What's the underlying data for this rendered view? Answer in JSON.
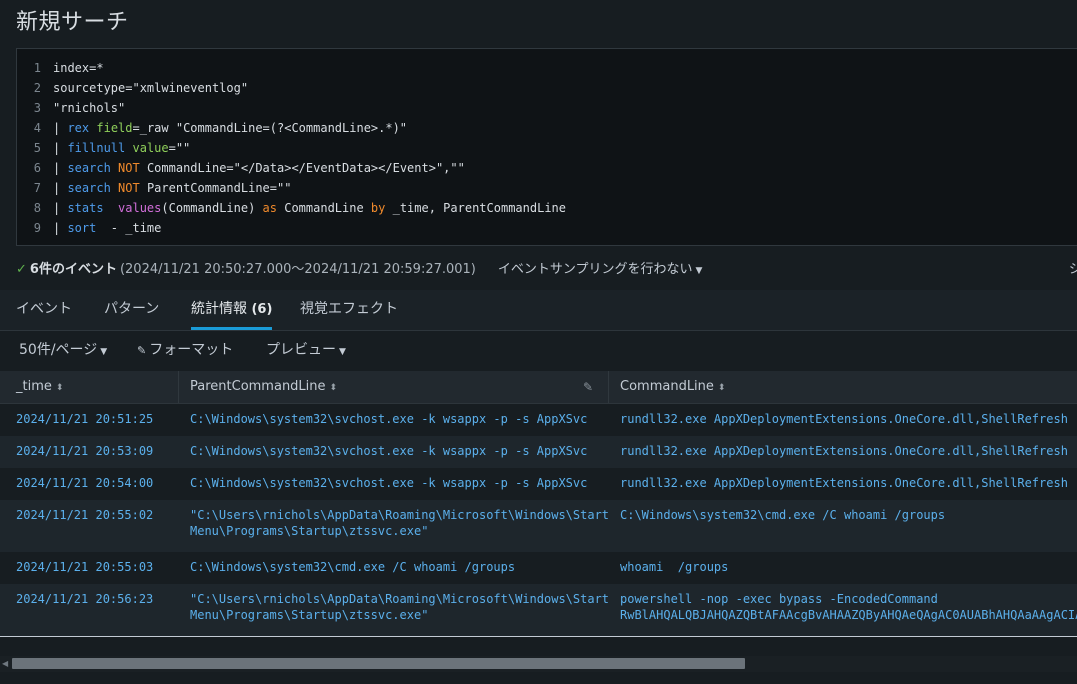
{
  "page": {
    "title": "新規サーチ"
  },
  "search": {
    "lines": [
      {
        "num": "1",
        "parts": [
          {
            "t": "index=*",
            "c": "code"
          }
        ]
      },
      {
        "num": "2",
        "parts": [
          {
            "t": "sourcetype=\"xmlwineventlog\"",
            "c": "code"
          }
        ]
      },
      {
        "num": "3",
        "parts": [
          {
            "t": "\"rnichols\"",
            "c": "code"
          }
        ]
      },
      {
        "num": "4",
        "parts": [
          {
            "t": "| ",
            "c": "c-pipe"
          },
          {
            "t": "rex",
            "c": "c-cmd"
          },
          {
            "t": " ",
            "c": "code"
          },
          {
            "t": "field",
            "c": "c-arg"
          },
          {
            "t": "=_raw \"CommandLine=(?<CommandLine>.*)\"",
            "c": "code"
          }
        ]
      },
      {
        "num": "5",
        "parts": [
          {
            "t": "| ",
            "c": "c-pipe"
          },
          {
            "t": "fillnull",
            "c": "c-cmd"
          },
          {
            "t": " ",
            "c": "code"
          },
          {
            "t": "value",
            "c": "c-arg"
          },
          {
            "t": "=\"\"",
            "c": "code"
          }
        ]
      },
      {
        "num": "6",
        "parts": [
          {
            "t": "| ",
            "c": "c-pipe"
          },
          {
            "t": "search",
            "c": "c-cmd"
          },
          {
            "t": " ",
            "c": "code"
          },
          {
            "t": "NOT",
            "c": "c-kw"
          },
          {
            "t": " CommandLine=\"</Data></EventData></Event>\",\"\"",
            "c": "code"
          }
        ]
      },
      {
        "num": "7",
        "parts": [
          {
            "t": "| ",
            "c": "c-pipe"
          },
          {
            "t": "search",
            "c": "c-cmd"
          },
          {
            "t": " ",
            "c": "code"
          },
          {
            "t": "NOT",
            "c": "c-kw"
          },
          {
            "t": " ParentCommandLine=\"\"",
            "c": "code"
          }
        ]
      },
      {
        "num": "8",
        "parts": [
          {
            "t": "| ",
            "c": "c-pipe"
          },
          {
            "t": "stats",
            "c": "c-cmd"
          },
          {
            "t": "  ",
            "c": "code"
          },
          {
            "t": "values",
            "c": "c-fn"
          },
          {
            "t": "(CommandLine) ",
            "c": "code"
          },
          {
            "t": "as",
            "c": "c-kw"
          },
          {
            "t": " CommandLine ",
            "c": "code"
          },
          {
            "t": "by",
            "c": "c-kw"
          },
          {
            "t": " _time, ParentCommandLine",
            "c": "code"
          }
        ]
      },
      {
        "num": "9",
        "parts": [
          {
            "t": "| ",
            "c": "c-pipe"
          },
          {
            "t": "sort",
            "c": "c-cmd"
          },
          {
            "t": "  - _time",
            "c": "code"
          }
        ]
      }
    ]
  },
  "status": {
    "check_icon": "check-icon",
    "count": "6件のイベント",
    "range": "(2024/11/21 20:50:27.000～2024/11/21 20:59:27.001)",
    "sampling": "イベントサンプリングを行わない",
    "job": "ジ"
  },
  "tabs": [
    {
      "label": "イベント",
      "count": ""
    },
    {
      "label": "パターン",
      "count": ""
    },
    {
      "label": "統計情報 ",
      "count": "(6)"
    },
    {
      "label": "視覚エフェクト",
      "count": ""
    }
  ],
  "toolbar": {
    "per_page": "50件/ページ",
    "format": "フォーマット",
    "preview": "プレビュー"
  },
  "table": {
    "columns": [
      "_time",
      "ParentCommandLine",
      "CommandLine"
    ],
    "rows": [
      {
        "time": "2024/11/21 20:51:25",
        "parent": "C:\\Windows\\system32\\svchost.exe -k wsappx -p -s AppXSvc",
        "cmd": "rundll32.exe AppXDeploymentExtensions.OneCore.dll,ShellRefresh"
      },
      {
        "time": "2024/11/21 20:53:09",
        "parent": "C:\\Windows\\system32\\svchost.exe -k wsappx -p -s AppXSvc",
        "cmd": "rundll32.exe AppXDeploymentExtensions.OneCore.dll,ShellRefresh"
      },
      {
        "time": "2024/11/21 20:54:00",
        "parent": "C:\\Windows\\system32\\svchost.exe -k wsappx -p -s AppXSvc",
        "cmd": "rundll32.exe AppXDeploymentExtensions.OneCore.dll,ShellRefresh"
      },
      {
        "time": "2024/11/21 20:55:02",
        "parent": "\"C:\\Users\\rnichols\\AppData\\Roaming\\Microsoft\\Windows\\Start\nMenu\\Programs\\Startup\\ztssvc.exe\"",
        "cmd": "C:\\Windows\\system32\\cmd.exe /C whoami /groups"
      },
      {
        "time": "2024/11/21 20:55:03",
        "parent": "C:\\Windows\\system32\\cmd.exe /C whoami /groups",
        "cmd": "whoami  /groups"
      },
      {
        "time": "2024/11/21 20:56:23",
        "parent": "\"C:\\Users\\rnichols\\AppData\\Roaming\\Microsoft\\Windows\\Start\nMenu\\Programs\\Startup\\ztssvc.exe\"",
        "cmd": "powershell -nop -exec bypass -EncodedCommand\nRwBlAHQALQBJAHQAZQBtAFAAcgBvAHAAZQByAHQAeQAgAC0AUABhAHQAaAAgACIASABL"
      }
    ]
  }
}
